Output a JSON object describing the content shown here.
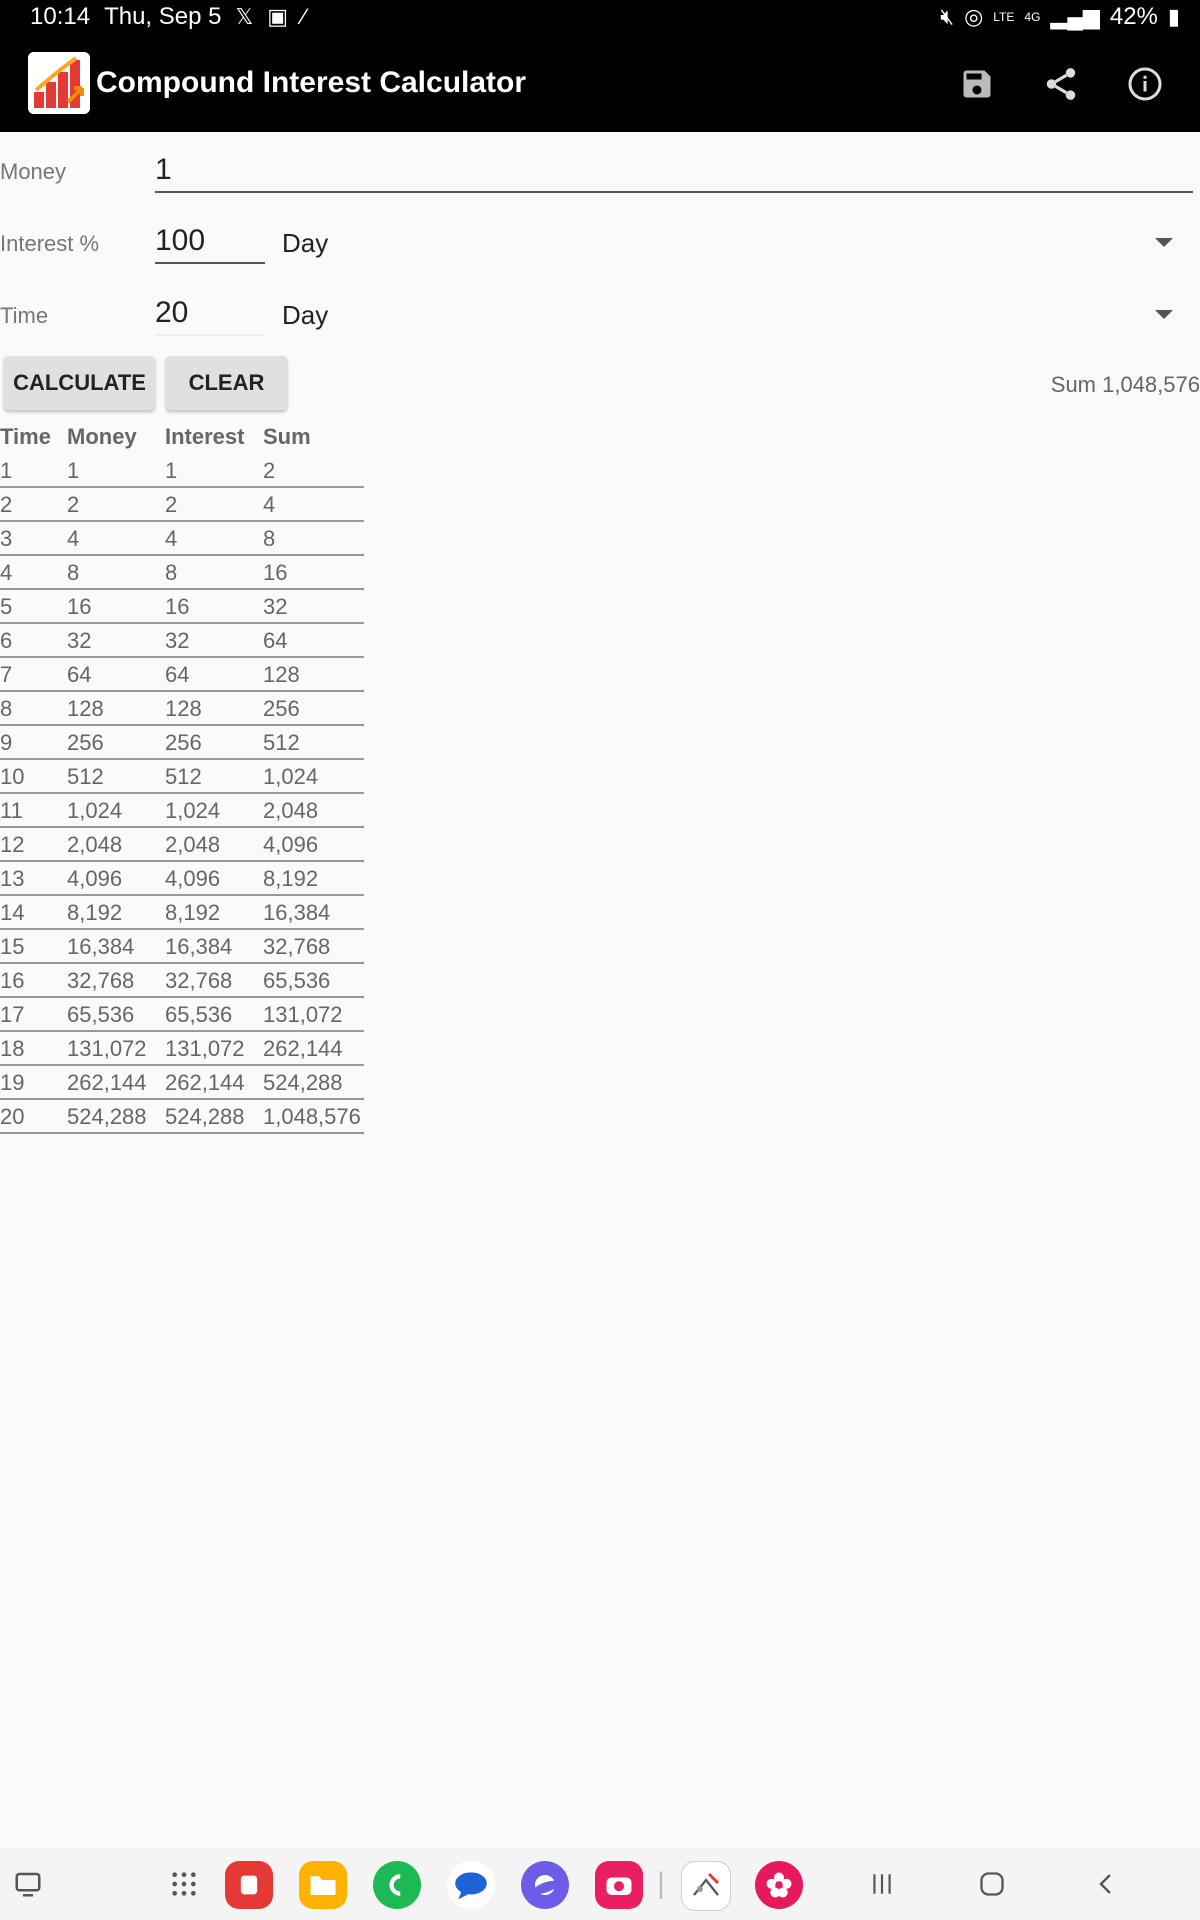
{
  "status": {
    "time": "10:14",
    "date": "Thu, Sep 5",
    "battery": "42%"
  },
  "app": {
    "title": "Compound Interest Calculator"
  },
  "form": {
    "money_label": "Money",
    "money_value": "1",
    "interest_label": "Interest %",
    "interest_value": "100",
    "interest_unit": "Day",
    "time_label": "Time",
    "time_value": "20",
    "time_unit": "Day"
  },
  "buttons": {
    "calculate": "CALCULATE",
    "clear": "CLEAR"
  },
  "result": {
    "sum_text": "Sum 1,048,576"
  },
  "table": {
    "headers": [
      "Time",
      "Money",
      "Interest",
      "Sum"
    ],
    "rows": [
      [
        "1",
        "1",
        "1",
        "2"
      ],
      [
        "2",
        "2",
        "2",
        "4"
      ],
      [
        "3",
        "4",
        "4",
        "8"
      ],
      [
        "4",
        "8",
        "8",
        "16"
      ],
      [
        "5",
        "16",
        "16",
        "32"
      ],
      [
        "6",
        "32",
        "32",
        "64"
      ],
      [
        "7",
        "64",
        "64",
        "128"
      ],
      [
        "8",
        "128",
        "128",
        "256"
      ],
      [
        "9",
        "256",
        "256",
        "512"
      ],
      [
        "10",
        "512",
        "512",
        "1,024"
      ],
      [
        "11",
        "1,024",
        "1,024",
        "2,048"
      ],
      [
        "12",
        "2,048",
        "2,048",
        "4,096"
      ],
      [
        "13",
        "4,096",
        "4,096",
        "8,192"
      ],
      [
        "14",
        "8,192",
        "8,192",
        "16,384"
      ],
      [
        "15",
        "16,384",
        "16,384",
        "32,768"
      ],
      [
        "16",
        "32,768",
        "32,768",
        "65,536"
      ],
      [
        "17",
        "65,536",
        "65,536",
        "131,072"
      ],
      [
        "18",
        "131,072",
        "131,072",
        "262,144"
      ],
      [
        "19",
        "262,144",
        "262,144",
        "524,288"
      ],
      [
        "20",
        "524,288",
        "524,288",
        "1,048,576"
      ]
    ]
  },
  "icons": {
    "save": "save-icon",
    "share": "share-icon",
    "info": "info-icon"
  },
  "colors": {
    "appbar": "#000000",
    "button": "#e0e0e0",
    "background": "#fafafa"
  }
}
